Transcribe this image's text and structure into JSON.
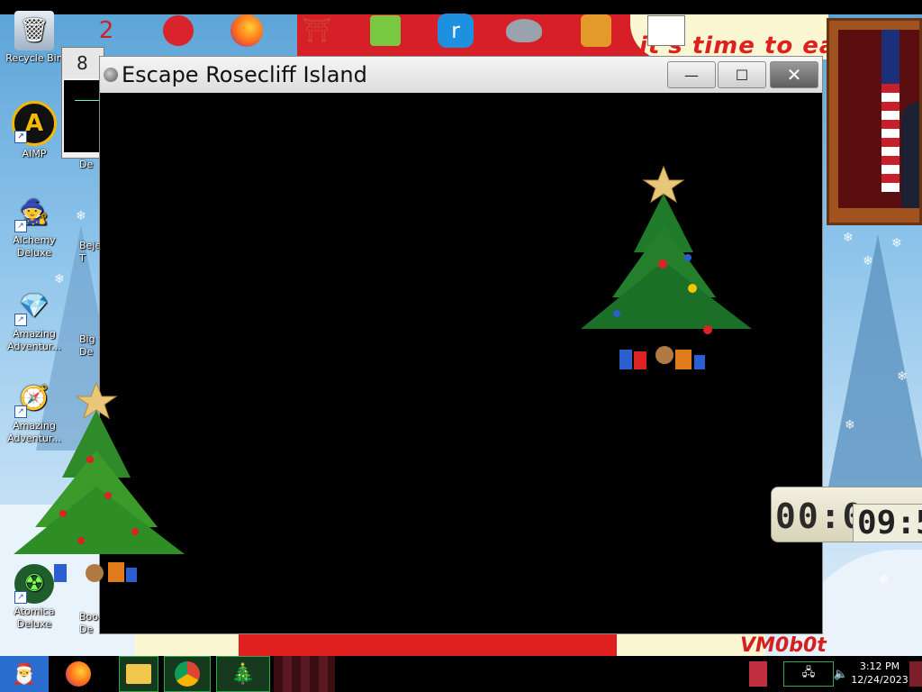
{
  "wallpaper": {
    "banner_text": "it's time to eat",
    "watermark_text": "VM0b0t"
  },
  "window": {
    "title": "Escape Rosecliff Island",
    "minimize_glyph": "—",
    "maximize_glyph": "☐",
    "close_glyph": "✕"
  },
  "mini_window": {
    "title_fragment": "8"
  },
  "desktop_icons": [
    {
      "label": "Recycle Bin",
      "glyph": "🗑"
    },
    {
      "label": "AIMP",
      "glyph": "A"
    },
    {
      "label": "Alchemy Deluxe",
      "glyph": "🧙"
    },
    {
      "label": "Amazing Adventur...",
      "glyph": "💎"
    },
    {
      "label": "Amazing Adventur...",
      "glyph": "🧭"
    },
    {
      "label": "Atomica Deluxe",
      "glyph": "☢"
    }
  ],
  "partial_icons": [
    {
      "label": "De"
    },
    {
      "label": "Beje T"
    },
    {
      "label": "Big De"
    },
    {
      "label": "Boo De"
    }
  ],
  "clock_widget": {
    "digits_main": "00:0",
    "digits_overlay": "09:5"
  },
  "taskbar": {
    "time": "3:12 PM",
    "date": "12/24/2023"
  },
  "icons": {
    "start": "santa-icon",
    "firefox": "firefox-icon",
    "explorer": "file-explorer-icon",
    "chrome": "chrome-icon",
    "tree_app": "christmas-tree-icon"
  },
  "colors": {
    "taskbar_bg": "#000000",
    "active_app_border": "#2ea84a",
    "window_content_bg": "#000000"
  }
}
